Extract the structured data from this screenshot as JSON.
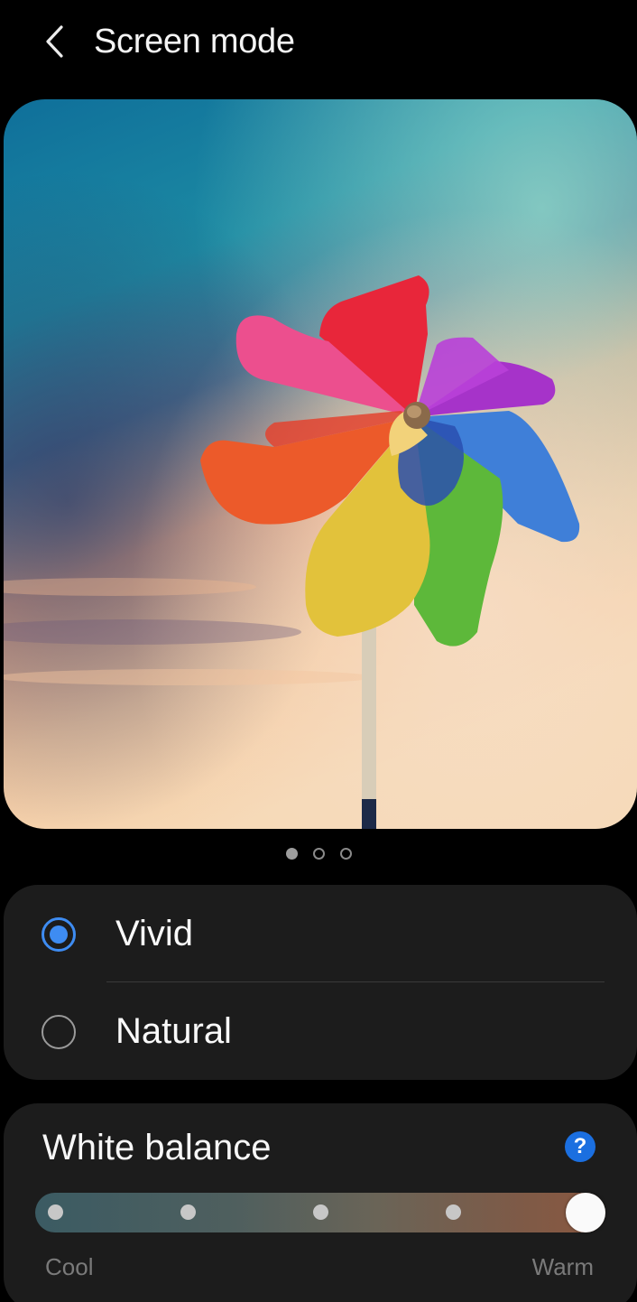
{
  "header": {
    "title": "Screen mode",
    "back_icon": "chevron-left-icon"
  },
  "preview": {
    "subject": "pinwheel",
    "page_count": 3,
    "active_page": 1
  },
  "modes": {
    "options": [
      {
        "label": "Vivid",
        "selected": true
      },
      {
        "label": "Natural",
        "selected": false
      }
    ],
    "accent_color": "#3e8cf2"
  },
  "white_balance": {
    "title": "White balance",
    "help_icon": "question-mark-icon",
    "help_symbol": "?",
    "min_label": "Cool",
    "max_label": "Warm",
    "steps": 5,
    "selected_step": 5
  }
}
